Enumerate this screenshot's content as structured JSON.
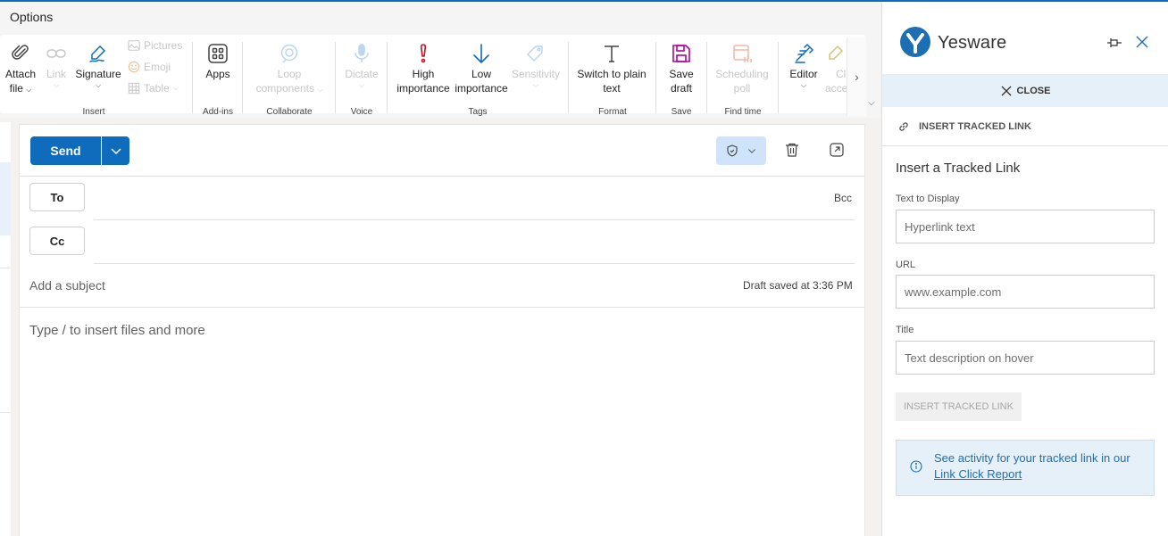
{
  "tabbar": {
    "active_tab": "Options"
  },
  "ribbon": {
    "buttons": {
      "attach_file": {
        "line1": "Attach",
        "line2": "file"
      },
      "link": {
        "line1": "Link"
      },
      "signature": {
        "line1": "Signature"
      },
      "pictures": "Pictures",
      "emoji": "Emoji",
      "table": "Table",
      "apps": "Apps",
      "loop": {
        "line1": "Loop",
        "line2": "components"
      },
      "dictate": "Dictate",
      "high_importance": {
        "line1": "High",
        "line2": "importance"
      },
      "low_importance": {
        "line1": "Low",
        "line2": "importance"
      },
      "sensitivity": "Sensitivity",
      "switch_plain": {
        "line1": "Switch to plain",
        "line2": "text"
      },
      "save_draft": {
        "line1": "Save",
        "line2": "draft"
      },
      "scheduling_poll": {
        "line1": "Scheduling",
        "line2": "poll"
      },
      "editor": "Editor",
      "clipped": {
        "line1": "Cl",
        "line2": "acce"
      }
    },
    "groups": {
      "insert": "Insert",
      "addins": "Add-ins",
      "collaborate": "Collaborate",
      "voice": "Voice",
      "tags": "Tags",
      "format": "Format",
      "save": "Save",
      "find_time": "Find time"
    },
    "colors": {
      "accent": "#0f6cbd",
      "high_importance": "#c50f1f",
      "low_importance": "#0f6cbd",
      "save_draft": "#b4009e",
      "disabled": "#c7c7c7"
    }
  },
  "compose": {
    "send_label": "Send",
    "to_label": "To",
    "cc_label": "Cc",
    "bcc_label": "Bcc",
    "subject_placeholder": "Add a subject",
    "draft_status": "Draft saved at 3:36 PM",
    "body_placeholder": "Type / to insert files and more"
  },
  "pane": {
    "brand": "Yesware",
    "close_label": "CLOSE",
    "section_label": "INSERT TRACKED LINK",
    "title": "Insert a Tracked Link",
    "fields": {
      "text_label": "Text to Display",
      "text_placeholder": "Hyperlink text",
      "url_label": "URL",
      "url_placeholder": "www.example.com",
      "title_label": "Title",
      "title_placeholder": "Text description on hover"
    },
    "insert_button": "INSERT TRACKED LINK",
    "info": {
      "text": "See activity for your tracked link in our ",
      "link": "Link Click Report"
    },
    "colors": {
      "brand_blue": "#1d6fb3",
      "info_bg": "#e6f0f8"
    }
  }
}
